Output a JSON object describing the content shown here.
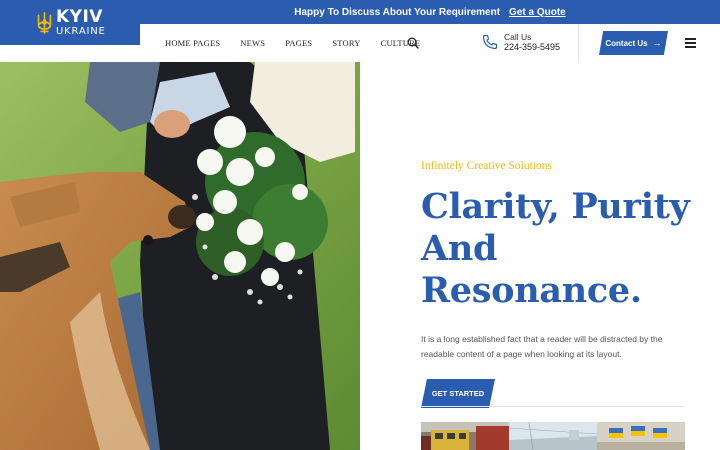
{
  "brand": {
    "name": "KYIV",
    "subtitle": "UKRAINE"
  },
  "topbar": {
    "message": "Happy To Discuss About Your Requirement",
    "link": "Get a Quote"
  },
  "nav": {
    "items": [
      {
        "label": "HOME PAGES"
      },
      {
        "label": "NEWS"
      },
      {
        "label": "PAGES"
      },
      {
        "label": "STORY"
      },
      {
        "label": "CULTURE"
      }
    ]
  },
  "contact": {
    "call_label": "Call Us",
    "phone": "224-359-5495",
    "button_label": "Contact Us"
  },
  "hero": {
    "tagline": "Infinitely Creative Solutions",
    "headline_line1": "Clarity, Purity",
    "headline_line2": "And",
    "headline_line3": "Resonance.",
    "description": "It is a long established fact that a reader will be distracted by the readable content of a page when looking at its layout.",
    "cta_label": "GET STARTED"
  },
  "icons": {
    "logo": "trident-icon",
    "search": "search-icon",
    "phone": "phone-icon",
    "arrow": "arrow-right-icon",
    "menu": "hamburger-menu-icon"
  },
  "colors": {
    "primary": "#2a5db0",
    "accent": "#f2b705",
    "text": "#333333"
  }
}
